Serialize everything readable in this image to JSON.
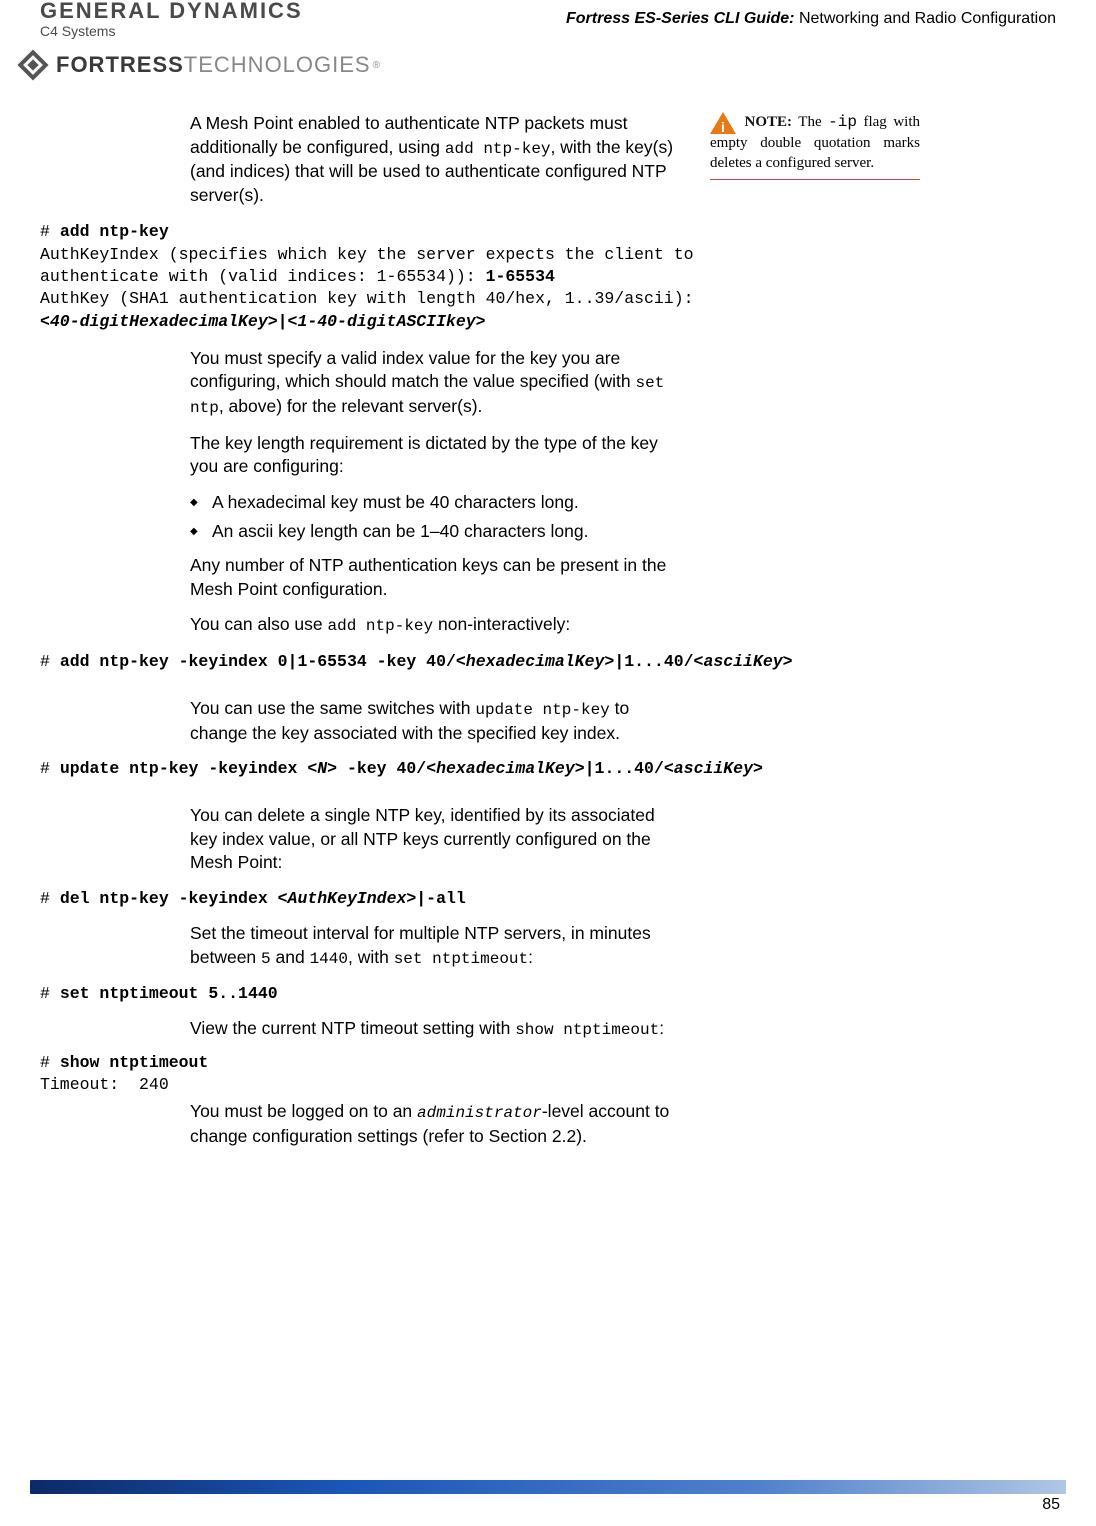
{
  "header": {
    "logo_top": "GENERAL DYNAMICS",
    "logo_sub": "C4 Systems",
    "right_bold": "Fortress ES-Series CLI Guide:",
    "right_plain": " Networking and Radio Configuration",
    "fortress_main": "FORTRESS",
    "fortress_sub": "TECHNOLOGIES",
    "fortress_reg": "®"
  },
  "note": {
    "label": "NOTE:",
    "text_part1": " The ",
    "code": "-ip",
    "text_part2": " flag with empty double quotation marks deletes a configured server."
  },
  "p1_a": "A Mesh Point enabled to authenticate NTP packets must additionally be configured, using ",
  "p1_code": "add ntp-key",
  "p1_b": ", with the key(s) (and indices) that will be used to authenticate configured NTP server(s).",
  "code1_l1_pre": "# ",
  "code1_l1_cmd": "add ntp-key",
  "code1_l2": "AuthKeyIndex (specifies which key the server expects the client to",
  "code1_l3_a": "authenticate with (valid indices: 1-65534)): ",
  "code1_l3_b": "1-65534",
  "code1_l4": "AuthKey (SHA1 authentication key with length 40/hex, 1..39/ascii):",
  "code1_l5": "<40-digitHexadecimalKey>|<1-40-digitASCIIkey>",
  "p2_a": "You must specify a valid index value for the key you are configuring, which should match the value specified (with ",
  "p2_code": "set ntp",
  "p2_b": ", above) for the relevant server(s).",
  "p3": "The key length requirement is dictated by the type of the key you are configuring:",
  "bullet1": "A hexadecimal key must be 40 characters long.",
  "bullet2": "An ascii key length can be 1–40 characters long.",
  "p4": "Any number of NTP authentication keys can be present in the Mesh Point configuration.",
  "p5_a": "You can also use ",
  "p5_code": "add ntp-key",
  "p5_b": " non-interactively:",
  "code2_pre": "# ",
  "code2_b1": "add ntp-key -keyindex 0|1-65534 -key 40/",
  "code2_i1": "<hexadecimalKey>",
  "code2_b2": "|1...40/",
  "code2_i2": "<asciiKey>",
  "p6_a": "You can use the same switches with ",
  "p6_code": "update ntp-key",
  "p6_b": " to change the key associated with the specified key index.",
  "code3_pre": "# ",
  "code3_b1": "update ntp-key -keyindex ",
  "code3_i1": "<N>",
  "code3_b2": " -key 40/",
  "code3_i2": "<hexadecimalKey>",
  "code3_b3": "|1...40/",
  "code3_i3": "<asciiKey>",
  "p7": "You can delete a single NTP key, identified by its associated key index value, or all NTP keys currently configured on the Mesh Point:",
  "code4_pre": "# ",
  "code4_b1": "del ntp-key -keyindex ",
  "code4_i1": "<AuthKeyIndex>",
  "code4_b2": "|-all",
  "p8_a": "Set the timeout interval for multiple NTP servers, in minutes between ",
  "p8_c1": "5",
  "p8_b": " and ",
  "p8_c2": "1440",
  "p8_c": ", with ",
  "p8_c3": "set ntptimeout",
  "p8_d": ":",
  "code5_pre": "# ",
  "code5_b": "set ntptimeout 5..1440",
  "p9_a": "View the current NTP timeout setting with ",
  "p9_code": "show ntptimeout",
  "p9_b": ":",
  "code6_pre": "# ",
  "code6_b": "show ntptimeout",
  "code6_l2": "Timeout:  240",
  "p10_a": "You must be logged on to an ",
  "p10_code": "administrator",
  "p10_b": "-level account to change configuration settings (refer to Section 2.2).",
  "page_number": "85"
}
